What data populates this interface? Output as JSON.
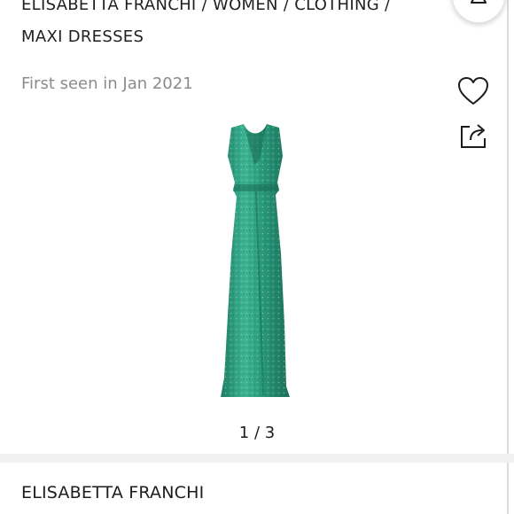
{
  "breadcrumb": {
    "items": [
      "ELISABETTA FRANCHI",
      "WOMEN",
      "CLOTHING",
      "MAXI DRESSES"
    ],
    "separator": " / "
  },
  "product": {
    "first_seen": "First seen in Jan 2021",
    "brand": "ELISABETTA FRANCHI",
    "dress_color": "#2f9b7d"
  },
  "gallery": {
    "pager": "1 / 3",
    "current": 1,
    "total": 3
  },
  "icons": {
    "favorite": "heart-icon",
    "share": "share-icon",
    "top_action": "triangle-icon"
  }
}
